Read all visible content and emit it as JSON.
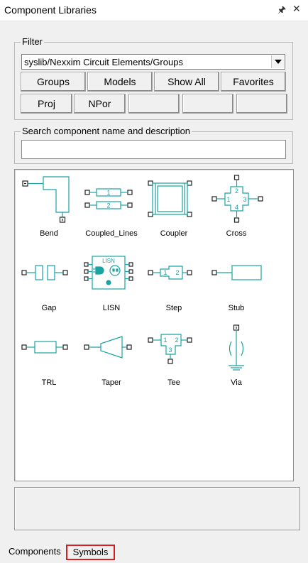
{
  "window": {
    "title": "Component Libraries",
    "pin_icon": "pin-icon",
    "close_icon": "close-icon"
  },
  "filter": {
    "legend": "Filter",
    "selected": "syslib/Nexxim Circuit Elements/Groups",
    "buttons_row1": [
      "Groups",
      "Models",
      "Show All",
      "Favorites"
    ],
    "buttons_row2": [
      "Proj",
      "NPor",
      "",
      "",
      ""
    ]
  },
  "search": {
    "legend": "Search component name and description",
    "value": "",
    "placeholder": ""
  },
  "components": [
    {
      "label": "Bend",
      "icon": "bend-icon"
    },
    {
      "label": "Coupled_Lines",
      "icon": "coupled-lines-icon"
    },
    {
      "label": "Coupler",
      "icon": "coupler-icon"
    },
    {
      "label": "Cross",
      "icon": "cross-icon"
    },
    {
      "label": "Gap",
      "icon": "gap-icon"
    },
    {
      "label": "LISN",
      "icon": "lisn-icon"
    },
    {
      "label": "Step",
      "icon": "step-icon"
    },
    {
      "label": "Stub",
      "icon": "stub-icon"
    },
    {
      "label": "TRL",
      "icon": "trl-icon"
    },
    {
      "label": "Taper",
      "icon": "taper-icon"
    },
    {
      "label": "Tee",
      "icon": "tee-icon"
    },
    {
      "label": "Via",
      "icon": "via-icon"
    }
  ],
  "symbol_text": {
    "coupled_port1": "1",
    "coupled_port2": "2",
    "cross_p1": "1",
    "cross_p2": "2",
    "cross_p3": "3",
    "cross_p4": "4",
    "lisn": "LISN",
    "step_p1": "1",
    "step_p2": "2",
    "tee_p1": "1",
    "tee_p2": "2",
    "tee_p3": "3"
  },
  "tabs": {
    "components": "Components",
    "symbols": "Symbols",
    "active": "Symbols"
  },
  "colors": {
    "symbol": "#1aa3a3",
    "tab_highlight": "#d81f26",
    "background": "#f0f0f0"
  }
}
